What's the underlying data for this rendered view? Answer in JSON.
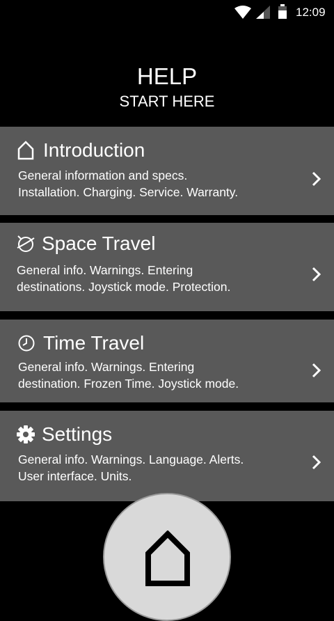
{
  "status_bar": {
    "time": "12:09",
    "icons": [
      "wifi-icon",
      "signal-icon",
      "battery-icon"
    ]
  },
  "header": {
    "title": "HELP",
    "subtitle": "START HERE"
  },
  "menu": [
    {
      "icon": "house-outline-icon",
      "title": "Introduction",
      "line1": "General information and specs.",
      "line2": "Installation. Charging. Service. Warranty."
    },
    {
      "icon": "planet-icon",
      "title": "Space Travel",
      "line1": "General info. Warnings. Entering",
      "line2": "destinations. Joystick mode. Protection."
    },
    {
      "icon": "clock-icon",
      "title": "Time Travel",
      "line1": "General info. Warnings. Entering",
      "line2": "destination. Frozen Time. Joystick mode."
    },
    {
      "icon": "gear-icon",
      "title": "Settings",
      "line1": "General info. Warnings. Language. Alerts.",
      "line2": "User interface. Units."
    }
  ],
  "fab": {
    "icon": "home-icon"
  },
  "colors": {
    "background": "#000000",
    "card": "#595959",
    "fab": "#d9d9d9"
  }
}
